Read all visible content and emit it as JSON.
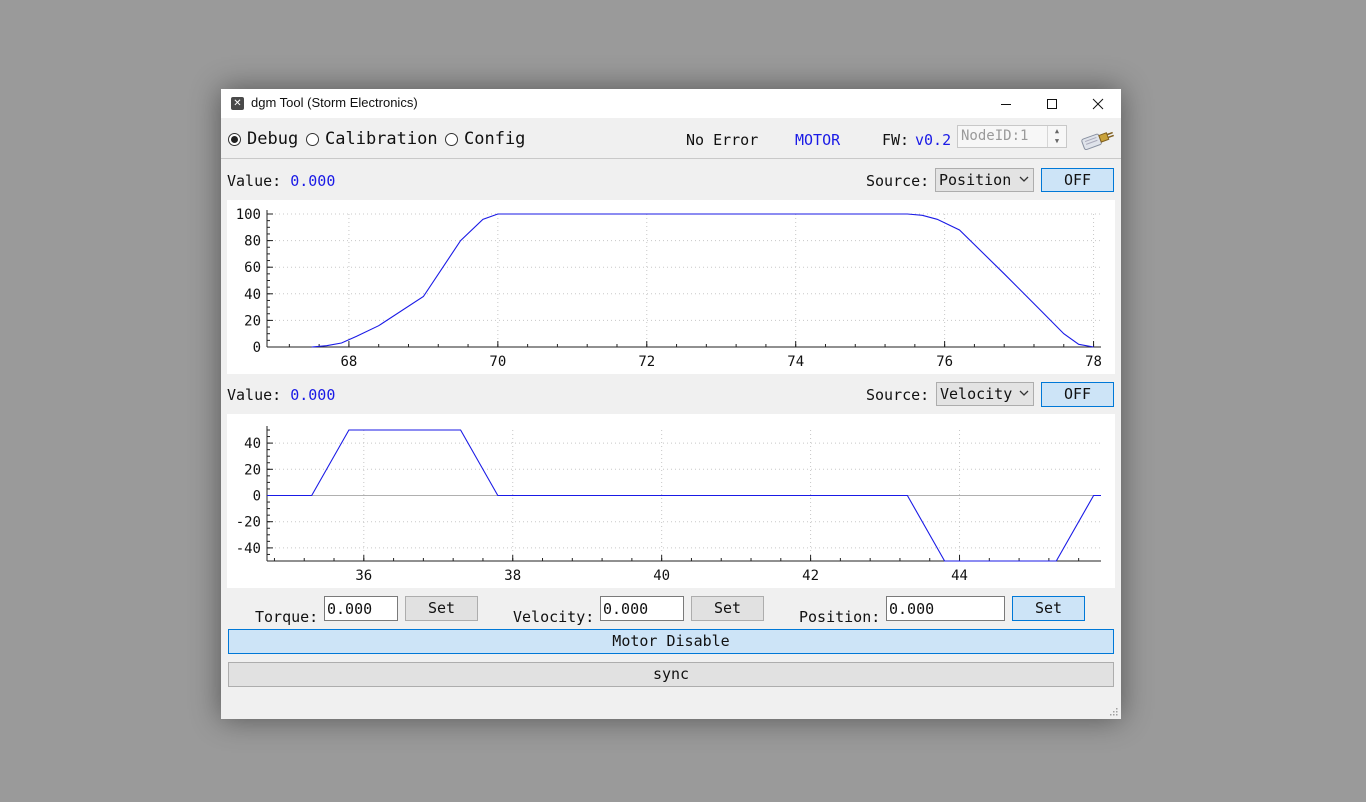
{
  "window": {
    "title": "dgm Tool (Storm Electronics)"
  },
  "toolbar": {
    "modes": [
      {
        "label": "Debug",
        "selected": true
      },
      {
        "label": "Calibration",
        "selected": false
      },
      {
        "label": "Config",
        "selected": false
      }
    ],
    "status": "No Error",
    "mode_tag": "MOTOR",
    "fw_label": "FW:",
    "fw_version": "v0.2",
    "node_id_placeholder": "NodeID:1"
  },
  "plot1": {
    "value_label": "Value:",
    "value": "0.000",
    "source_label": "Source:",
    "source_selected": "Position",
    "toggle_label": "OFF"
  },
  "plot2": {
    "value_label": "Value:",
    "value": "0.000",
    "source_label": "Source:",
    "source_selected": "Velocity",
    "toggle_label": "OFF"
  },
  "controls": {
    "torque_label": "Torque:",
    "torque_value": "0.000",
    "velocity_label": "Velocity:",
    "velocity_value": "0.000",
    "position_label": "Position:",
    "position_value": "0.000",
    "set_label": "Set",
    "motor_button": "Motor Disable",
    "sync_button": "sync"
  },
  "colors": {
    "trace": "#1a1ae6",
    "highlight_button": "#cde4f7",
    "value_text": "#1a1ae6"
  },
  "chart_data": [
    {
      "type": "line",
      "name": "position",
      "xlim": [
        66.9,
        78.1
      ],
      "ylim": [
        0,
        100
      ],
      "xticks": [
        68,
        70,
        72,
        74,
        76,
        78
      ],
      "yticks": [
        0,
        20,
        40,
        60,
        80,
        100
      ],
      "grid": true,
      "series": [
        {
          "x": [
            67.5,
            67.7,
            67.9,
            68.1,
            68.4,
            69.0,
            69.5,
            69.8,
            70.0,
            70.2,
            75.0,
            75.5,
            75.7,
            75.9,
            76.2,
            76.8,
            77.3,
            77.6,
            77.8,
            78.0
          ],
          "y": [
            0,
            1,
            3,
            8,
            16,
            38,
            80,
            96,
            100,
            100,
            100,
            100,
            99,
            96,
            88,
            55,
            27,
            10,
            2,
            0
          ]
        }
      ]
    },
    {
      "type": "line",
      "name": "velocity",
      "xlim": [
        34.7,
        45.9
      ],
      "ylim": [
        -50,
        50
      ],
      "xticks": [
        36,
        38,
        40,
        42,
        44
      ],
      "yticks": [
        -40,
        -20,
        0,
        20,
        40
      ],
      "grid": true,
      "series": [
        {
          "x": [
            34.7,
            35.3,
            35.8,
            37.3,
            37.8,
            43.3,
            43.8,
            45.3,
            45.8,
            45.9
          ],
          "y": [
            0,
            0,
            50,
            50,
            0,
            0,
            -50,
            -50,
            0,
            0
          ]
        }
      ]
    }
  ]
}
